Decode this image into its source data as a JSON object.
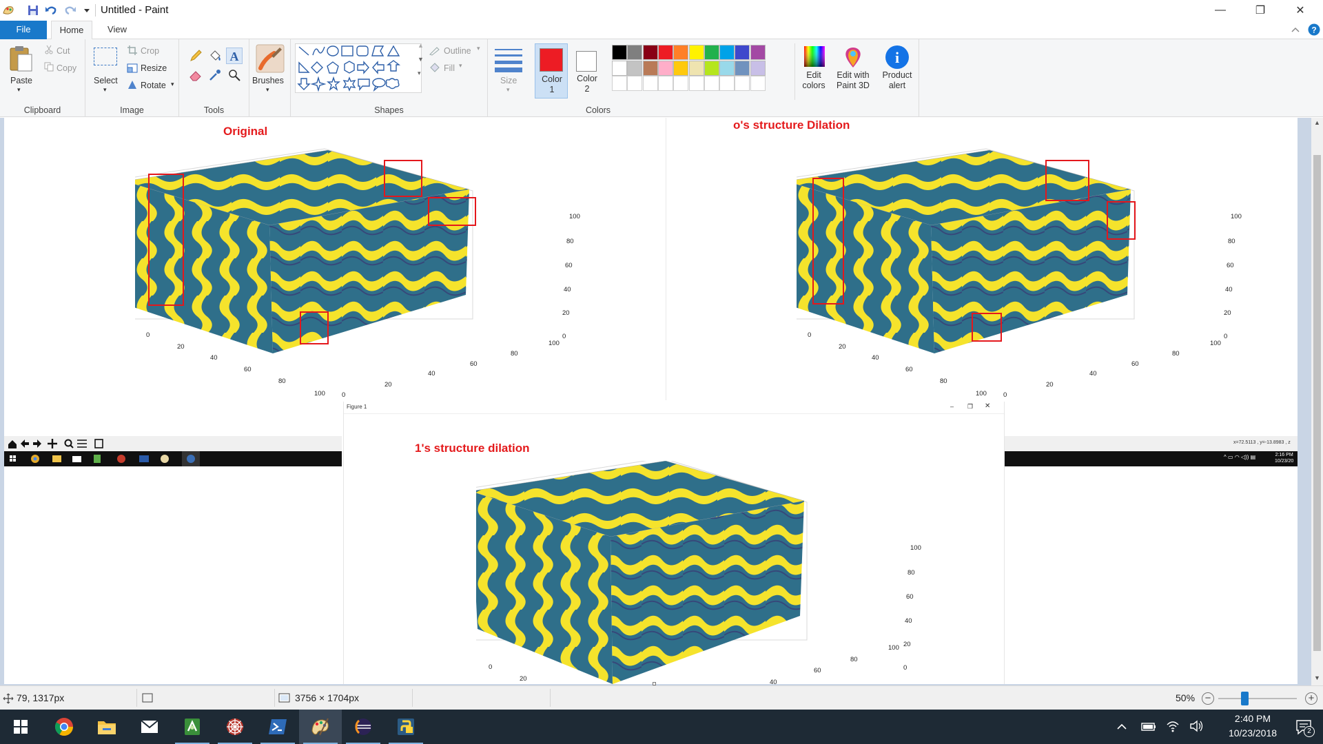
{
  "window": {
    "title": "Untitled - Paint",
    "controls": {
      "minimize": "—",
      "maximize": "❐",
      "close": "✕"
    }
  },
  "tabs": [
    {
      "label": "File",
      "active": false
    },
    {
      "label": "Home",
      "active": true
    },
    {
      "label": "View",
      "active": false
    }
  ],
  "ribbon": {
    "clipboard": {
      "paste": "Paste",
      "cut": "Cut",
      "copy": "Copy",
      "group": "Clipboard"
    },
    "image": {
      "select": "Select",
      "crop": "Crop",
      "resize": "Resize",
      "rotate": "Rotate",
      "group": "Image"
    },
    "tools": {
      "group": "Tools"
    },
    "brushes": {
      "label": "Brushes"
    },
    "shapes": {
      "outline": "Outline",
      "fill": "Fill",
      "group": "Shapes"
    },
    "size": {
      "label": "Size"
    },
    "colors": {
      "color1": "Color\n1",
      "color1_line1": "Color",
      "color1_line2": "1",
      "color2_line1": "Color",
      "color2_line2": "2",
      "edit_line1": "Edit",
      "edit_line2": "colors",
      "paint3d_line1": "Edit with",
      "paint3d_line2": "Paint 3D",
      "alert_line1": "Product",
      "alert_line2": "alert",
      "group": "Colors",
      "color1_value": "#ed1c24",
      "color2_value": "#ffffff",
      "palette_row1": [
        "#000000",
        "#7f7f7f",
        "#880015",
        "#ed1c24",
        "#ff7f27",
        "#fff200",
        "#22b14c",
        "#00a2e8",
        "#3f48cc",
        "#a349a4"
      ],
      "palette_row2": [
        "#ffffff",
        "#c3c3c3",
        "#b97a57",
        "#ffaec9",
        "#ffc90e",
        "#efe4b0",
        "#b5e61d",
        "#99d9ea",
        "#7092be",
        "#c8bfe7"
      ]
    }
  },
  "canvas": {
    "panels": {
      "original": {
        "title": "Original"
      },
      "zero_dilation": {
        "title": "o's structure Dilation"
      },
      "one_dilation": {
        "title": "1's structure dilation",
        "window_title": "Figure 1"
      }
    },
    "axis_ticks": {
      "z": [
        "100",
        "80",
        "60",
        "40",
        "20",
        "0"
      ],
      "x": [
        "0",
        "20",
        "40",
        "60",
        "80",
        "100"
      ],
      "y": [
        "0",
        "20",
        "40",
        "60",
        "80",
        "100"
      ]
    },
    "inner_status_text": "x=72.5113 , y=-13.8983 , z",
    "inner_clock": {
      "time": "2:16 PM",
      "date": "10/23/20"
    }
  },
  "statusbar": {
    "cursor_pos": "79, 1317px",
    "image_size": "3756 × 1704px",
    "zoom": "50%",
    "zoom_level_percent": 50
  },
  "taskbar": {
    "apps": [
      "start",
      "chrome",
      "file-explorer",
      "mail",
      "android-studio",
      "spider-app",
      "powershell",
      "paint",
      "eclipse",
      "python"
    ],
    "time": "2:40 PM",
    "date": "10/23/2018",
    "notifications": "2"
  }
}
